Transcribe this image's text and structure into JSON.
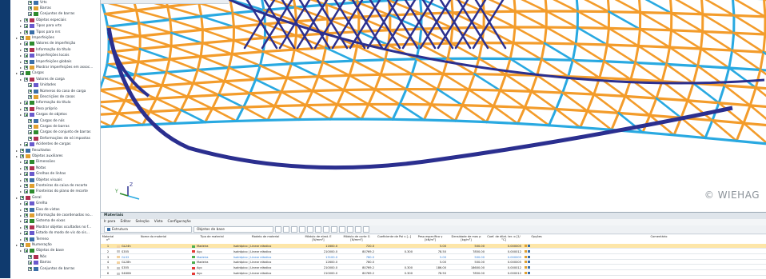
{
  "nav": {
    "items": [
      {
        "label": "Vrts",
        "level": 3
      },
      {
        "label": "Barras",
        "level": 3
      },
      {
        "label": "Conjuntos de barras",
        "level": 3
      },
      {
        "label": "Objetos especiais",
        "level": 2
      },
      {
        "label": "Tipos para vrts",
        "level": 2
      },
      {
        "label": "Tipos para nrs",
        "level": 2
      },
      {
        "label": "Imperfeições",
        "level": 1
      },
      {
        "label": "Valores de imperfeição",
        "level": 2
      },
      {
        "label": "Informação do título",
        "level": 2
      },
      {
        "label": "Imperfeições locais",
        "level": 2
      },
      {
        "label": "Imperfeições globais",
        "level": 2
      },
      {
        "label": "Mostrar imperfeições em assoc...",
        "level": 2
      },
      {
        "label": "Cargas",
        "level": 1
      },
      {
        "label": "Valores de carga",
        "level": 2
      },
      {
        "label": "Unidades",
        "level": 3
      },
      {
        "label": "Números do caso de carga",
        "level": 3
      },
      {
        "label": "Descrições de casos",
        "level": 3
      },
      {
        "label": "Informação do título",
        "level": 2
      },
      {
        "label": "Peso próprio",
        "level": 2
      },
      {
        "label": "Cargas de objetos",
        "level": 2
      },
      {
        "label": "Cargas de nós",
        "level": 3
      },
      {
        "label": "Cargas de barras",
        "level": 3
      },
      {
        "label": "Cargas de conjunto de barras",
        "level": 3
      },
      {
        "label": "Deformações de nó impostas",
        "level": 3
      },
      {
        "label": "Acidentes de cargas",
        "level": 2
      },
      {
        "label": "Resultados",
        "level": 1
      },
      {
        "label": "Objetos auxiliares",
        "level": 1
      },
      {
        "label": "Dimensões",
        "level": 2
      },
      {
        "label": "Notas",
        "level": 2
      },
      {
        "label": "Grelhas de linhas",
        "level": 2
      },
      {
        "label": "Objetos visuais",
        "level": 2
      },
      {
        "label": "Fronteiras da caixa de recorte",
        "level": 2
      },
      {
        "label": "Fronteiras do plano de recorte",
        "level": 2
      },
      {
        "label": "Geral",
        "level": 1
      },
      {
        "label": "Grelha",
        "level": 2
      },
      {
        "label": "Eixo de vistas",
        "level": 2
      },
      {
        "label": "Informação de coordenadas no...",
        "level": 2
      },
      {
        "label": "Sistema de eixos",
        "level": 2
      },
      {
        "label": "Mostrar objetos ocultados no f...",
        "level": 2
      },
      {
        "label": "Estado do modo de vis do sis...",
        "level": 2
      },
      {
        "label": "Terreno",
        "level": 2
      },
      {
        "label": "Numeração",
        "level": 1
      },
      {
        "label": "Objetos de base",
        "level": 2
      },
      {
        "label": "Nós",
        "level": 3
      },
      {
        "label": "Barras",
        "level": 3
      },
      {
        "label": "Conjuntos de barras",
        "level": 3
      }
    ]
  },
  "viewport": {
    "copyright": "© WIEHAG",
    "axis_y": "Y",
    "axis_z": "Z"
  },
  "panel": {
    "title": "Materiais",
    "menu": [
      "Ir para",
      "Editar",
      "Seleção",
      "Vista",
      "Configuração"
    ],
    "dropdown1": "Estrutura",
    "dropdown2": "Objetos de base",
    "columns": [
      "Material nº",
      "Nome do material",
      "Tipo de material",
      "Modelo de material",
      "Módulo de elast. E [N/mm²]",
      "Módulo de corte G [N/mm²]",
      "Coeficiente de Poi ν [--]",
      "Peso específico γ [kN/m³]",
      "Densidade de mas ρ [kg/m³]",
      "Coef. de dilat. ter. α [1/°C]",
      "Opções",
      "Comentário"
    ],
    "rows": [
      {
        "no": "1",
        "name": "GL24h",
        "type": "Madeira",
        "model": "Isotrópico | Linear elástico",
        "E": "11600.0",
        "G": "720.0",
        "nu": "",
        "gamma": "5.00",
        "rho": "500.00",
        "alpha": "0.000005",
        "sw": "#4caf50",
        "sel": true
      },
      {
        "no": "2",
        "name": "S355",
        "type": "Aço",
        "model": "Isotrópico | Linear elástico",
        "E": "210000.0",
        "G": "80769.2",
        "nu": "0.300",
        "gamma": "78.50",
        "rho": "7850.00",
        "alpha": "0.000012",
        "sw": "#e53935",
        "sel": false
      },
      {
        "no": "3",
        "name": "GL32",
        "type": "Madeira",
        "model": "Isotrópico | Linear elástico",
        "E": "13100.0",
        "G": "780.0",
        "nu": "",
        "gamma": "5.00",
        "rho": "500.00",
        "alpha": "0.000005",
        "sw": "#4caf50",
        "sel": false,
        "edit": true
      },
      {
        "no": "4",
        "name": "GL28h",
        "type": "Madeira",
        "model": "Isotrópico | Linear elástico",
        "E": "12600.0",
        "G": "780.0",
        "nu": "",
        "gamma": "5.00",
        "rho": "500.00",
        "alpha": "0.000005",
        "sw": "#4caf50",
        "sel": false
      },
      {
        "no": "5",
        "name": "S355",
        "type": "Aço",
        "model": "Isotrópico | Linear elástico",
        "E": "210000.0",
        "G": "80769.2",
        "nu": "0.300",
        "gamma": "186.00",
        "rho": "18600.00",
        "alpha": "0.000012",
        "sw": "#e53935",
        "sel": false
      },
      {
        "no": "6",
        "name": "S460N",
        "type": "Aço",
        "model": "Isotrópico | Linear elástico",
        "E": "210000.0",
        "G": "80769.2",
        "nu": "0.300",
        "gamma": "78.50",
        "rho": "7850.00",
        "alpha": "0.000012",
        "sw": "#e53935",
        "sel": false
      }
    ]
  },
  "colors": {
    "timber": "#f39c2b",
    "steel_light": "#29a9e1",
    "steel_dark": "#2b2f8f"
  }
}
